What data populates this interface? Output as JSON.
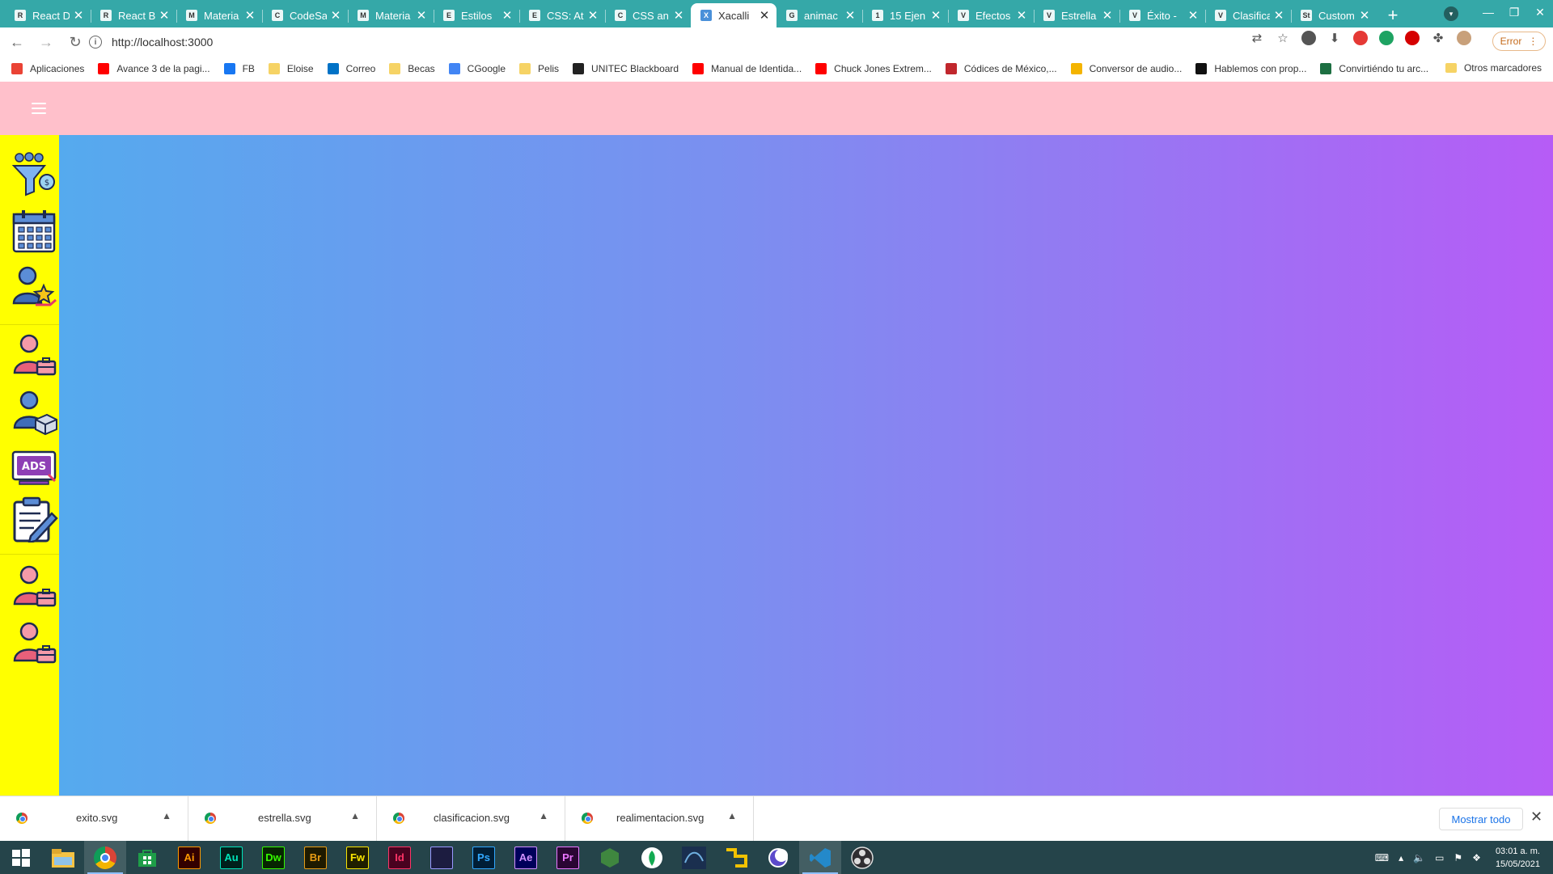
{
  "browser": {
    "tabs": [
      {
        "title": "React D",
        "fav": "R"
      },
      {
        "title": "React B",
        "fav": "R"
      },
      {
        "title": "Materia",
        "fav": "M"
      },
      {
        "title": "CodeSa",
        "fav": "C"
      },
      {
        "title": "Materia",
        "fav": "M"
      },
      {
        "title": "Estilos",
        "fav": "E"
      },
      {
        "title": "CSS: At",
        "fav": "E"
      },
      {
        "title": "CSS an",
        "fav": "C"
      },
      {
        "title": "Xacalli",
        "fav": "X"
      },
      {
        "title": "animac",
        "fav": "G"
      },
      {
        "title": "15 Ejen",
        "fav": "1"
      },
      {
        "title": "Efectos",
        "fav": "V"
      },
      {
        "title": "Estrella",
        "fav": "V"
      },
      {
        "title": "Éxito -",
        "fav": "V"
      },
      {
        "title": "Clasifica",
        "fav": "V"
      },
      {
        "title": "Custom",
        "fav": "St"
      }
    ],
    "url": "http://localhost:3000",
    "error_label": "Error",
    "bookmarks": [
      {
        "label": "Aplicaciones",
        "color": "#ea4335"
      },
      {
        "label": "Avance 3 de la pagi...",
        "color": "#ff0000"
      },
      {
        "label": "FB",
        "color": "#1877f2"
      },
      {
        "label": "Eloise",
        "color": "#f6d365"
      },
      {
        "label": "Correo",
        "color": "#0072c6"
      },
      {
        "label": "Becas",
        "color": "#f6d365"
      },
      {
        "label": "CGoogle",
        "color": "#4285f4"
      },
      {
        "label": "Pelis",
        "color": "#f6d365"
      },
      {
        "label": "UNITEC Blackboard",
        "color": "#222222"
      },
      {
        "label": "Manual de Identida...",
        "color": "#ff0000"
      },
      {
        "label": "Chuck Jones Extrem...",
        "color": "#ff0000"
      },
      {
        "label": "Códices de México,...",
        "color": "#c1272d"
      },
      {
        "label": "Conversor de audio...",
        "color": "#f4b400"
      },
      {
        "label": "Hablemos con prop...",
        "color": "#111111"
      },
      {
        "label": "Convirtiéndo tu arc...",
        "color": "#1d6f42"
      }
    ],
    "bookmarks_more": "»",
    "other_bookmarks": "Otros marcadores"
  },
  "page": {
    "menu_icon": "hamburger-icon",
    "header_color": "#ffc0cb",
    "sidebar_color": "#ffff00",
    "sidebar_items": [
      "funnel-people-icon",
      "calendar-icon",
      "person-star-icon",
      "person-briefcase-icon",
      "person-boxes-icon",
      "ads-monitor-icon",
      "clipboard-edit-icon",
      "person-briefcase-icon",
      "person-briefcase-icon"
    ],
    "gradient": [
      "#55aaee",
      "#7b8ff0",
      "#b65cf6"
    ]
  },
  "downloads": {
    "items": [
      "exito.svg",
      "estrella.svg",
      "clasificacion.svg",
      "realimentacion.svg"
    ],
    "show_all": "Mostrar todo"
  },
  "taskbar": {
    "apps": [
      {
        "name": "windows-start"
      },
      {
        "name": "file-explorer"
      },
      {
        "name": "chrome",
        "active": true
      },
      {
        "name": "store"
      },
      {
        "name": "illustrator",
        "label": "Ai",
        "bg": "#330000",
        "fg": "#ff9a00"
      },
      {
        "name": "audition",
        "label": "Au",
        "bg": "#00201b",
        "fg": "#00e4bb"
      },
      {
        "name": "dreamweaver",
        "label": "Dw",
        "bg": "#072401",
        "fg": "#35fa00"
      },
      {
        "name": "bridge",
        "label": "Br",
        "bg": "#1e1a00",
        "fg": "#e89c14"
      },
      {
        "name": "fireworks",
        "label": "Fw",
        "bg": "#1f1e00",
        "fg": "#f9e500"
      },
      {
        "name": "indesign",
        "label": "Id",
        "bg": "#49021f",
        "fg": "#ff3366"
      },
      {
        "name": "unknown-app",
        "label": "",
        "bg": "#1c1c40",
        "fg": "#9999ff"
      },
      {
        "name": "photoshop",
        "label": "Ps",
        "bg": "#001e36",
        "fg": "#31a8ff"
      },
      {
        "name": "after-effects",
        "label": "Ae",
        "bg": "#00005b",
        "fg": "#d291ff"
      },
      {
        "name": "premiere",
        "label": "Pr",
        "bg": "#2a0634",
        "fg": "#ea77ff"
      },
      {
        "name": "node-js"
      },
      {
        "name": "mongodb"
      },
      {
        "name": "mysql-workbench"
      },
      {
        "name": "git-tool"
      },
      {
        "name": "eclipse"
      },
      {
        "name": "vs-code",
        "active": true
      },
      {
        "name": "obs-studio"
      }
    ],
    "time": "03:01 a. m.",
    "date": "15/05/2021"
  }
}
